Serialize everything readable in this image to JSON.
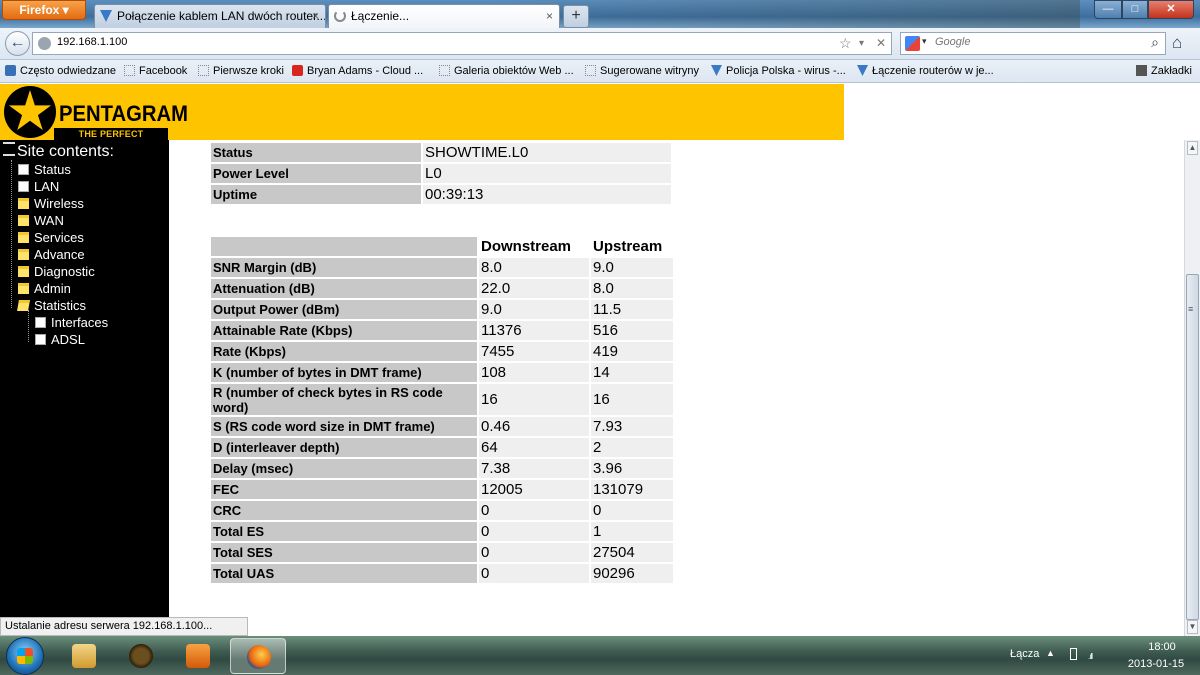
{
  "browser": {
    "menu_button": "Firefox",
    "tabs": [
      {
        "title": "Połączenie kablem LAN dwóch router...",
        "close": "×"
      },
      {
        "title": "Łączenie...",
        "close": "×"
      }
    ],
    "new_tab": "+",
    "window_buttons": {
      "minimize": "—",
      "maximize": "□",
      "close": "✕"
    },
    "back": "←",
    "url": "192.168.1.100",
    "url_buttons": {
      "bookmark": "☆",
      "history": "▾",
      "stop": "✕"
    },
    "search_engine_menu": "▾",
    "search_placeholder": "Google",
    "search_button": "⌕",
    "home": "⌂",
    "bookmarks": [
      {
        "label": "Często odwiedzane",
        "icon": "rss-icon"
      },
      {
        "label": "Facebook",
        "icon": "page-icon"
      },
      {
        "label": "Pierwsze kroki",
        "icon": "page-icon"
      },
      {
        "label": "Bryan Adams - Cloud ...",
        "icon": "youtube-icon"
      },
      {
        "label": "Galeria obiektów Web ...",
        "icon": "page-icon"
      },
      {
        "label": "Sugerowane witryny",
        "icon": "page-icon"
      },
      {
        "label": "Policja Polska - wirus -...",
        "icon": "pentagram-icon"
      },
      {
        "label": "Łączenie routerów w je...",
        "icon": "pentagram-icon"
      }
    ],
    "bookmarks_menu": "Zakładki",
    "status_text": "Ustalanie adresu serwera 192.168.1.100..."
  },
  "router": {
    "brand": "PENTAGRAM",
    "tagline": "THE PERFECT SIMPLICITY",
    "sidebar": {
      "title": "Site contents:",
      "items": [
        {
          "label": "Status",
          "icon": "doc"
        },
        {
          "label": "LAN",
          "icon": "doc"
        },
        {
          "label": "Wireless",
          "icon": "folder"
        },
        {
          "label": "WAN",
          "icon": "folder"
        },
        {
          "label": "Services",
          "icon": "folder"
        },
        {
          "label": "Advance",
          "icon": "folder"
        },
        {
          "label": "Diagnostic",
          "icon": "folder"
        },
        {
          "label": "Admin",
          "icon": "folder"
        },
        {
          "label": "Statistics",
          "icon": "folder-open"
        }
      ],
      "subitems": [
        {
          "label": "Interfaces",
          "icon": "doc"
        },
        {
          "label": "ADSL",
          "icon": "doc"
        }
      ]
    },
    "status_table": [
      {
        "label": "Status",
        "value": "SHOWTIME.L0"
      },
      {
        "label": "Power Level",
        "value": "L0"
      },
      {
        "label": "Uptime",
        "value": "00:39:13"
      }
    ],
    "adsl_table": {
      "headers": [
        "Downstream",
        "Upstream"
      ],
      "rows": [
        {
          "label": "SNR Margin (dB)",
          "down": "8.0",
          "up": "9.0"
        },
        {
          "label": "Attenuation (dB)",
          "down": "22.0",
          "up": "8.0"
        },
        {
          "label": "Output Power (dBm)",
          "down": "9.0",
          "up": "11.5"
        },
        {
          "label": "Attainable Rate (Kbps)",
          "down": "11376",
          "up": "516"
        },
        {
          "label": "Rate (Kbps)",
          "down": "7455",
          "up": "419"
        },
        {
          "label": "K (number of bytes in DMT frame)",
          "down": "108",
          "up": "14"
        },
        {
          "label": "R (number of check bytes in RS code word)",
          "down": "16",
          "up": "16"
        },
        {
          "label": "S (RS code word size in DMT frame)",
          "down": "0.46",
          "up": "7.93"
        },
        {
          "label": "D (interleaver depth)",
          "down": "64",
          "up": "2"
        },
        {
          "label": "Delay (msec)",
          "down": "7.38",
          "up": "3.96"
        },
        {
          "label": "FEC",
          "down": "12005",
          "up": "131079"
        },
        {
          "label": "CRC",
          "down": "0",
          "up": "0"
        },
        {
          "label": "Total ES",
          "down": "0",
          "up": "1"
        },
        {
          "label": "Total SES",
          "down": "0",
          "up": "27504"
        },
        {
          "label": "Total UAS",
          "down": "0",
          "up": "90296"
        }
      ]
    }
  },
  "taskbar": {
    "language": "Łącza",
    "tray_expand": "▲",
    "network": ".ıll",
    "time": "18:00",
    "date": "2013-01-15"
  },
  "colors": {
    "banner": "#ffc400",
    "sidebar_bg": "#000000",
    "label_cell": "#c8c8c8",
    "value_cell": "#efefef"
  }
}
